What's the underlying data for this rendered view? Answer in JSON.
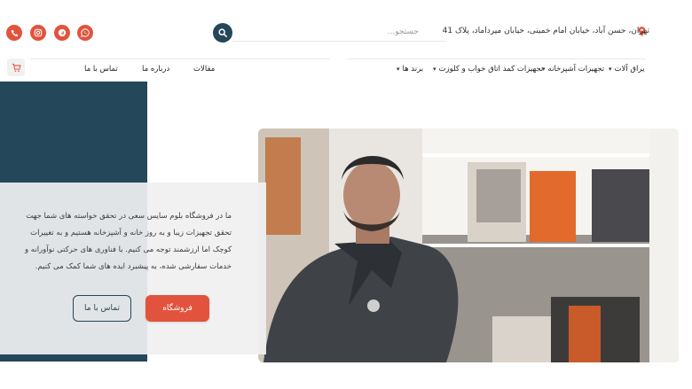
{
  "header": {
    "address": "تهران، حسن آباد، خیابان امام خمینی، خیابان میرداماد، پلاک 41",
    "search": {
      "placeholder": "جستجو...",
      "value": ""
    },
    "social": [
      "phone-icon",
      "instagram-icon",
      "telegram-icon",
      "whatsapp-icon"
    ]
  },
  "nav": {
    "items": [
      {
        "label": "یراق آلات",
        "dropdown": true
      },
      {
        "label": "تجهیزات آشپزخانه",
        "dropdown": true
      },
      {
        "label": "تجهیزات کمد اتاق خواب و کلوزت",
        "dropdown": true
      },
      {
        "label": "برند ها",
        "dropdown": true
      },
      {
        "label": "مقالات",
        "dropdown": false
      },
      {
        "label": "درباره ما",
        "dropdown": false
      },
      {
        "label": "تماس با ما",
        "dropdown": false
      }
    ],
    "cart_icon": "cart-icon"
  },
  "hero": {
    "text": "ما در فروشگاه بلوم سایس سعی در تحقق خواسته های شما جهت تحقق تجهیزات زیبا و به روز خانه و آشپزخانه هستیم و به تغییرات کوچک اما ارزشمند توجه می کنیم. با فناوری های حرکتی نوآورانه و خدمات سفارشی شده، به پیشبرد ایده های شما کمک می کنیم.",
    "shop_button": "فروشگاه",
    "contact_button": "تماس با ما"
  },
  "colors": {
    "accent": "#e2533d",
    "navy": "#24475a"
  }
}
